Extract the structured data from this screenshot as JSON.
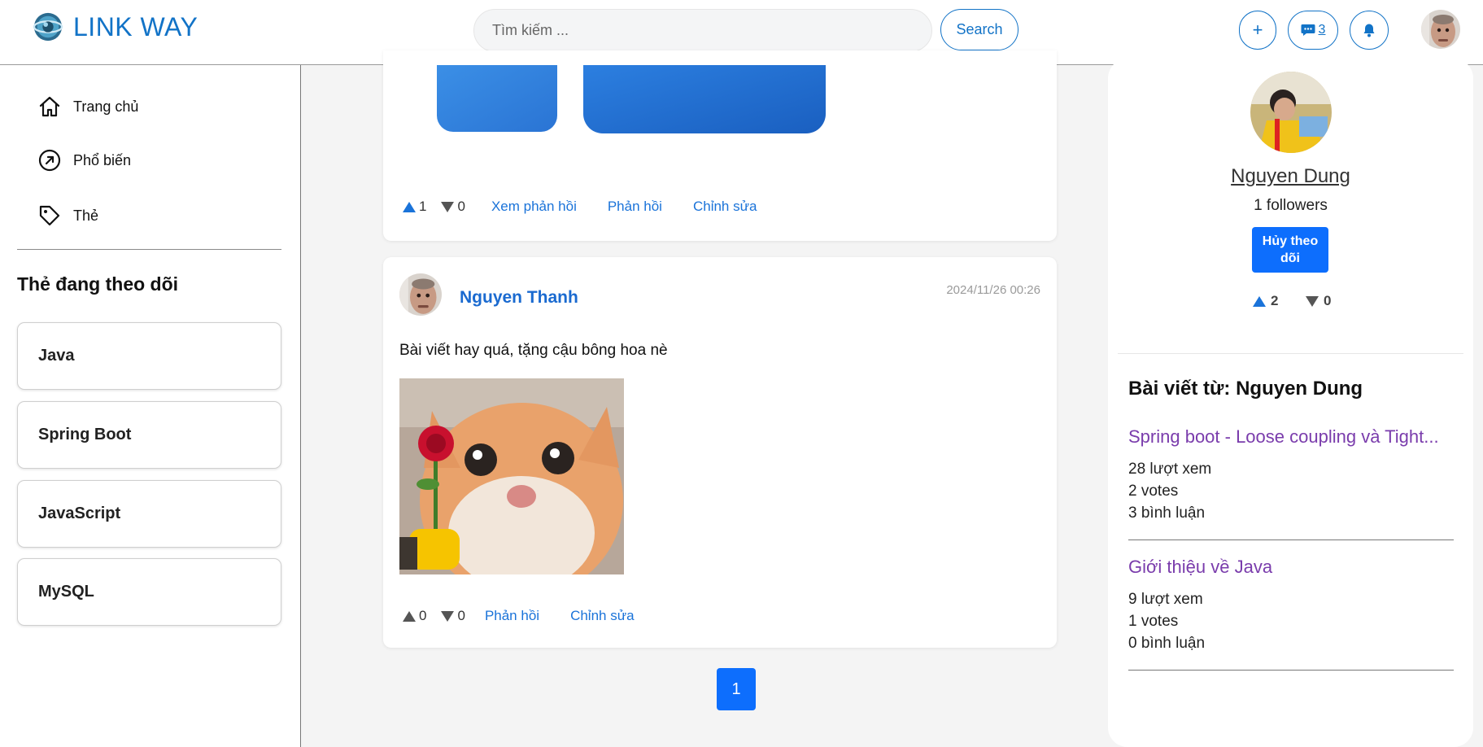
{
  "header": {
    "brand": "LINK WAY",
    "search_placeholder": "Tìm kiếm ...",
    "search_button": "Search",
    "plus_label": "+",
    "message_count": "3"
  },
  "sidebar": {
    "nav": [
      {
        "label": "Trang chủ",
        "icon": "home-icon"
      },
      {
        "label": "Phổ biến",
        "icon": "trending-icon"
      },
      {
        "label": "Thẻ",
        "icon": "tag-icon"
      }
    ],
    "followed_title": "Thẻ đang theo dõi",
    "followed_tags": [
      "Java",
      "Spring Boot",
      "JavaScript",
      "MySQL"
    ]
  },
  "feed": {
    "reply1": {
      "up": "1",
      "down": "0",
      "actions": [
        "Xem phản hồi",
        "Phản hồi",
        "Chỉnh sửa"
      ]
    },
    "reply2": {
      "author": "Nguyen Thanh",
      "timestamp": "2024/11/26 00:26",
      "text": "Bài viết hay quá, tặng cậu bông hoa nè",
      "up": "0",
      "down": "0",
      "actions": [
        "Phản hồi",
        "Chỉnh sửa"
      ]
    },
    "page": "1"
  },
  "profile": {
    "name": "Nguyen Dung",
    "followers": "1 followers",
    "unfollow_label": "Hủy theo dõi",
    "up": "2",
    "down": "0",
    "posts_title": "Bài viết từ: Nguyen Dung",
    "posts": [
      {
        "title": "Spring boot - Loose coupling và Tight...",
        "views": "28 lượt xem",
        "votes": "2 votes",
        "comments": "3 bình luận"
      },
      {
        "title": "Giới thiệu về Java",
        "views": "9 lượt xem",
        "votes": "1 votes",
        "comments": "0 bình luận"
      }
    ]
  },
  "colors": {
    "brand": "#1273c7",
    "accent": "#0d6efd",
    "post_link": "#7a3cac"
  }
}
